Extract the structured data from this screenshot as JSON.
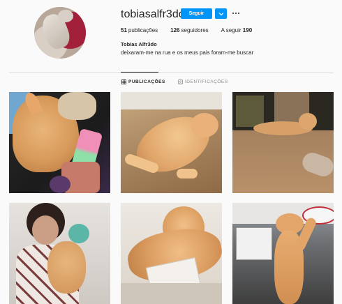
{
  "profile": {
    "username": "tobiasalfr3do",
    "follow_label": "Seguir",
    "full_name": "Tobias Alfr3do",
    "bio": "deixaram-me na rua e os meus pais foram-me buscar"
  },
  "stats": {
    "posts_count": "51",
    "posts_label": "publicações",
    "followers_count": "126",
    "followers_label": "seguidores",
    "following_label": "A seguir",
    "following_count": "190"
  },
  "tabs": {
    "posts": "PUBLICAÇÕES",
    "tagged": "IDENTIFICAÇÕES"
  },
  "colors": {
    "accent": "#0095f6",
    "text": "#262626",
    "muted": "#8e8e8e",
    "background": "#fafafa"
  },
  "icons": {
    "dropdown": "chevron-down-icon",
    "more": "more-options-icon",
    "posts_tab": "grid-icon",
    "tagged_tab": "tag-icon"
  }
}
